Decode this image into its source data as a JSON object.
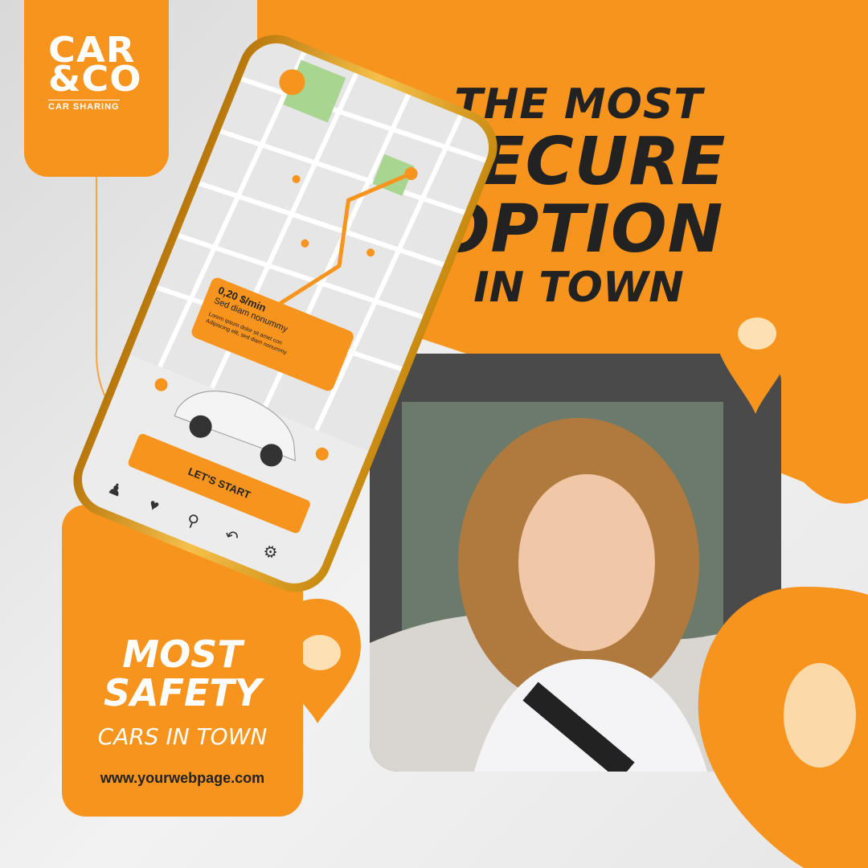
{
  "brand": {
    "logo_line1": "CAR",
    "logo_line2": "&CO",
    "logo_sub": "CAR SHARING",
    "accent": "#f7941d",
    "dark": "#222222"
  },
  "headline": {
    "line1": "THE MOST",
    "line2": "SECURE",
    "line3": "OPTION",
    "line4": "IN TOWN"
  },
  "phone": {
    "price": "0,20 $/min",
    "subtitle": "Sed diam nonummy",
    "lorem1": "Lorem ipsum dolor sit amet con",
    "lorem2": "Adipiscing elit, sed diam nonummy",
    "button": "LET'S START",
    "nav_icons": [
      "user-icon",
      "heart-icon",
      "location-icon",
      "back-icon",
      "gear-icon"
    ]
  },
  "card": {
    "line1": "MOST",
    "line2": "SAFETY",
    "line3": "CARS IN TOWN",
    "url": "www.yourwebpage.com"
  }
}
